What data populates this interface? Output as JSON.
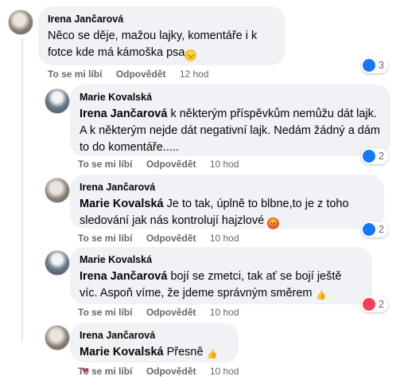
{
  "actions": {
    "like": "To se mi líbí",
    "reply": "Odpovědět"
  },
  "comments": [
    {
      "author": "Irena Jančarová",
      "text": "Něco se děje, mažou lajky, komentáře i k fotce kde má kámoška psa",
      "time": "12 hod",
      "reaction_count": "3"
    },
    {
      "author": "Marie Kovalská",
      "mention": "Irena Jančarová",
      "text": " k některým příspěvkům nemůžu dát lajk. A k některým nejde dát negativní lajk. Nedám žádný a dám to do komentáře.....",
      "time": "10 hod",
      "reaction_count": "2"
    },
    {
      "author": "Irena Jančarová",
      "mention": "Marie Kovalská",
      "text": " Je to tak, úplně to blbne,to je z toho sledování jak nás kontrolují hajzlové",
      "time": "10 hod",
      "reaction_count": "2"
    },
    {
      "author": "Marie Kovalská",
      "mention": "Irena Jančarová",
      "text": " bojí se zmetci, tak ať se bojí ještě víc. Aspoň víme, že jdeme správným směrem ",
      "time": "10 hod",
      "reaction_count": "2"
    },
    {
      "author": "Irena Jančarová",
      "mention": "Marie Kovalská",
      "text": " Přesně ",
      "time": "10 hod"
    }
  ],
  "colors": {
    "like": "#1877f2",
    "heart": "#f33e58",
    "haha": "#f7b125",
    "bubble": "#f0f2f5"
  }
}
